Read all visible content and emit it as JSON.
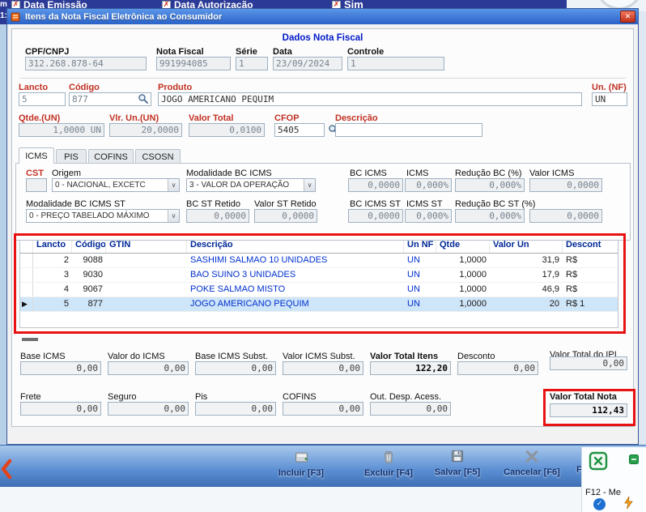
{
  "parent": {
    "top_items": [
      {
        "label": "Data Emissão"
      },
      {
        "label": "Data Autorização"
      },
      {
        "label": "Sim"
      }
    ],
    "left_scrap_top": "m",
    "left_scrap_bottom": "1:",
    "footer_buttons": [
      {
        "label": "Incluir [F3]"
      },
      {
        "label": "Excluir [F4]"
      },
      {
        "label": "Salvar [F5]"
      },
      {
        "label": "Cancelar [F6]"
      },
      {
        "label": "Fe"
      }
    ],
    "desktop": {
      "f12_label": "F12 - Me"
    }
  },
  "dialog": {
    "title": "Itens da Nota Fiscal Eletrônica ao Consumidor",
    "close_glyph": "✕",
    "section_title": "Dados Nota Fiscal",
    "header": {
      "cpf_label": "CPF/CNPJ",
      "cpf_value": "312.268.878-64",
      "nf_label": "Nota Fiscal",
      "nf_value": "991994085",
      "serie_label": "Série",
      "serie_value": "1",
      "data_label": "Data",
      "data_value": "23/09/2024",
      "controle_label": "Controle",
      "controle_value": "1"
    },
    "item": {
      "lancto_label": "Lancto",
      "lancto_value": "5",
      "codigo_label": "Código",
      "codigo_value": "877",
      "produto_label": "Produto",
      "produto_value": "JOGO AMERICANO PEQUIM",
      "un_label": "Un. (NF)",
      "un_value": "UN",
      "qtde_label": "Qtde.(UN)",
      "qtde_value": "1,0000 UN",
      "vlr_label": "Vlr. Un.(UN)",
      "vlr_value": "20,0000",
      "vtotal_label": "Valor Total",
      "vtotal_value": "0,0100",
      "cfop_label": "CFOP",
      "cfop_value": "5405",
      "descricao_label": "Descrição",
      "descricao_value": ""
    },
    "tabs": [
      "ICMS",
      "PIS",
      "COFINS",
      "CSOSN"
    ],
    "icms": {
      "cst_label": "CST",
      "cst_value": "",
      "origem_label": "Origem",
      "origem_value": "0 - NACIONAL, EXCETC",
      "mod_bc_label": "Modalidade BC ICMS",
      "mod_bc_value": "3 - VALOR DA OPERAÇÃO",
      "bc_icms_label": "BC ICMS",
      "bc_icms_value": "0,0000",
      "icms_label": "ICMS",
      "icms_value": "0,000%",
      "red_bc_label": "Redução BC (%)",
      "red_bc_value": "0,000%",
      "valor_icms_label": "Valor ICMS",
      "valor_icms_value": "0,0000",
      "mod_bc_st_label": "Modalidade BC ICMS ST",
      "mod_bc_st_value": "0 - PREÇO TABELADO MÁXIMO",
      "bc_st_retido_label": "BC ST Retido",
      "bc_st_retido_value": "0,0000",
      "valor_st_retido_label": "Valor ST Retido",
      "valor_st_retido_value": "0,0000",
      "bc_icms_st_label": "BC ICMS ST",
      "bc_icms_st_value": "0,0000",
      "icms_st_label": "ICMS ST",
      "icms_st_value": "0,000%",
      "red_bc_st_label": "Redução BC ST (%)",
      "red_bc_st_value": "0,000%",
      "valor_icms_st_value": "0,0000"
    },
    "grid": {
      "columns": [
        "Lancto",
        "Código",
        "GTIN",
        "Descrição",
        "Un NF",
        "Qtde",
        "Valor Un",
        "Descont"
      ],
      "rows": [
        {
          "selected": false,
          "cells": [
            "2",
            "9088",
            "",
            "SASHIMI SALMAO 10 UNIDADES",
            "UN",
            "1,0000",
            "31,9",
            "R$"
          ]
        },
        {
          "selected": false,
          "cells": [
            "3",
            "9030",
            "",
            "BAO SUINO 3 UNIDADES",
            "UN",
            "1,0000",
            "17,9",
            "R$"
          ]
        },
        {
          "selected": false,
          "cells": [
            "4",
            "9067",
            "",
            "POKE SALMAO MISTO",
            "UN",
            "1,0000",
            "46,9",
            "R$"
          ]
        },
        {
          "selected": true,
          "cells": [
            "5",
            "877",
            "",
            "JOGO AMERICANO PEQUIM",
            "UN",
            "1,0000",
            "20",
            "R$ 1"
          ]
        }
      ]
    },
    "totals1": {
      "base_icms_label": "Base ICMS",
      "base_icms_value": "0,00",
      "valor_icms_label": "Valor do ICMS",
      "valor_icms_value": "0,00",
      "base_st_label": "Base ICMS Subst.",
      "base_st_value": "0,00",
      "valor_st_label": "Valor ICMS Subst.",
      "valor_st_value": "0,00",
      "total_itens_label": "Valor Total Itens",
      "total_itens_value": "122,20",
      "desconto_label": "Desconto",
      "desconto_value": "0,00",
      "ipi_label": "Valor Total do IPI",
      "ipi_value": "0,00"
    },
    "totals2": {
      "frete_label": "Frete",
      "frete_value": "0,00",
      "seguro_label": "Seguro",
      "seguro_value": "0,00",
      "pis_label": "Pis",
      "pis_value": "0,00",
      "cofins_label": "COFINS",
      "cofins_value": "0,00",
      "outras_label": "Out. Desp. Acess.",
      "outras_value": "0,00",
      "total_nota_label": "Valor Total Nota",
      "total_nota_value": "112,43"
    }
  }
}
